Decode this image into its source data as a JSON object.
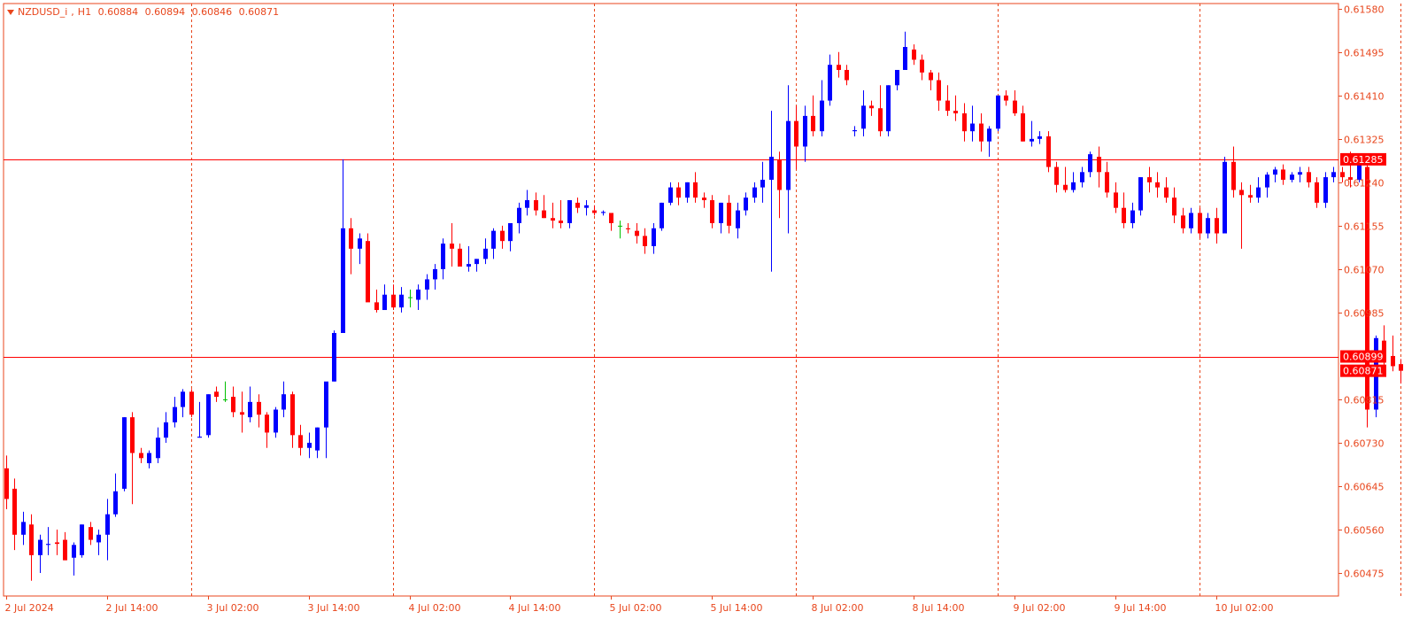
{
  "chart_data": {
    "type": "candlestick",
    "title": {
      "symbol": "NZDUSD_i",
      "timeframe": "H1",
      "open": "0.60884",
      "high": "0.60894",
      "low": "0.60846",
      "close": "0.60871"
    },
    "ylim": [
      0.6043,
      0.6159
    ],
    "y_ticks": [
      "0.61580",
      "0.61495",
      "0.61410",
      "0.61325",
      "0.61240",
      "0.61155",
      "0.61070",
      "0.60985",
      "0.60815",
      "0.60730",
      "0.60645",
      "0.60560",
      "0.60475"
    ],
    "x_ticks": [
      {
        "i": 0,
        "label": "2 Jul 2024"
      },
      {
        "i": 12,
        "label": "2 Jul 14:00"
      },
      {
        "i": 24,
        "label": "3 Jul 02:00"
      },
      {
        "i": 36,
        "label": "3 Jul 14:00"
      },
      {
        "i": 48,
        "label": "4 Jul 02:00"
      },
      {
        "i": 60,
        "label": "4 Jul 14:00"
      },
      {
        "i": 72,
        "label": "5 Jul 02:00"
      },
      {
        "i": 84,
        "label": "5 Jul 14:00"
      },
      {
        "i": 96,
        "label": "8 Jul 02:00"
      },
      {
        "i": 108,
        "label": "8 Jul 14:00"
      },
      {
        "i": 120,
        "label": "9 Jul 02:00"
      },
      {
        "i": 132,
        "label": "9 Jul 14:00"
      },
      {
        "i": 144,
        "label": "10 Jul 02:00"
      }
    ],
    "day_separators": [
      22,
      46,
      70,
      94,
      118,
      142,
      166
    ],
    "horizontal_lines": [
      {
        "value": 0.61285,
        "label": "0.61285"
      },
      {
        "value": 0.60899,
        "label": "0.60899"
      }
    ],
    "current_price": {
      "value": 0.60871,
      "label": "0.60871"
    },
    "colors": {
      "bull": "#0000ff",
      "bear": "#ff0000",
      "doji": "#00c000",
      "axis": "#e8461c",
      "grid": "#e8461c",
      "level_line": "#ff0000",
      "background": "#ffffff"
    },
    "candles": [
      [
        0.6068,
        0.60705,
        0.606,
        0.6062
      ],
      [
        0.6064,
        0.6066,
        0.6052,
        0.6055
      ],
      [
        0.6055,
        0.60595,
        0.6053,
        0.60575
      ],
      [
        0.6057,
        0.6059,
        0.6046,
        0.6051
      ],
      [
        0.6051,
        0.6055,
        0.60475,
        0.6054
      ],
      [
        0.6053,
        0.60565,
        0.6051,
        0.60532
      ],
      [
        0.60535,
        0.6056,
        0.6051,
        0.60532
      ],
      [
        0.6054,
        0.60555,
        0.605,
        0.605
      ],
      [
        0.60505,
        0.60535,
        0.6047,
        0.6053
      ],
      [
        0.6051,
        0.6057,
        0.60505,
        0.6057
      ],
      [
        0.60565,
        0.60575,
        0.6053,
        0.6054
      ],
      [
        0.60535,
        0.6056,
        0.6051,
        0.6055
      ],
      [
        0.6055,
        0.6062,
        0.605,
        0.6059
      ],
      [
        0.6059,
        0.6067,
        0.60585,
        0.60635
      ],
      [
        0.6064,
        0.6078,
        0.60635,
        0.6078
      ],
      [
        0.6078,
        0.6079,
        0.6061,
        0.6071
      ],
      [
        0.6071,
        0.6072,
        0.6069,
        0.607
      ],
      [
        0.6069,
        0.60715,
        0.6068,
        0.6071
      ],
      [
        0.607,
        0.6076,
        0.6069,
        0.6074
      ],
      [
        0.6074,
        0.6079,
        0.6073,
        0.6077
      ],
      [
        0.6077,
        0.6082,
        0.6076,
        0.608
      ],
      [
        0.608,
        0.60835,
        0.6078,
        0.6083
      ],
      [
        0.6083,
        0.60835,
        0.6078,
        0.60785
      ],
      [
        0.6074,
        0.6081,
        0.6074,
        0.60742
      ],
      [
        0.60745,
        0.60825,
        0.6074,
        0.60825
      ],
      [
        0.6083,
        0.6084,
        0.6081,
        0.6082
      ],
      [
        0.60815,
        0.6085,
        0.6081,
        0.60815
      ],
      [
        0.6082,
        0.6084,
        0.6078,
        0.6079
      ],
      [
        0.6079,
        0.6083,
        0.6075,
        0.60785
      ],
      [
        0.6078,
        0.6084,
        0.6077,
        0.6081
      ],
      [
        0.6081,
        0.60825,
        0.6076,
        0.60785
      ],
      [
        0.60785,
        0.6079,
        0.6072,
        0.6075
      ],
      [
        0.6075,
        0.608,
        0.6074,
        0.60795
      ],
      [
        0.60795,
        0.6085,
        0.6078,
        0.60825
      ],
      [
        0.60825,
        0.6083,
        0.6072,
        0.60745
      ],
      [
        0.60745,
        0.60765,
        0.60705,
        0.6072
      ],
      [
        0.6072,
        0.6075,
        0.607,
        0.6073
      ],
      [
        0.60715,
        0.6076,
        0.607,
        0.6076
      ],
      [
        0.6076,
        0.6084,
        0.607,
        0.6085
      ],
      [
        0.6085,
        0.6095,
        0.6085,
        0.60945
      ],
      [
        0.60945,
        0.61285,
        0.60945,
        0.6115
      ],
      [
        0.6115,
        0.6117,
        0.6106,
        0.6111
      ],
      [
        0.6111,
        0.6114,
        0.6108,
        0.6113
      ],
      [
        0.61125,
        0.6114,
        0.6104,
        0.61005
      ],
      [
        0.61005,
        0.6103,
        0.60985,
        0.6099
      ],
      [
        0.6099,
        0.6104,
        0.6099,
        0.6102
      ],
      [
        0.6102,
        0.6104,
        0.6099,
        0.60995
      ],
      [
        0.60995,
        0.61035,
        0.60985,
        0.6102
      ],
      [
        0.61015,
        0.6103,
        0.60995,
        0.61015
      ],
      [
        0.6101,
        0.6104,
        0.6099,
        0.6103
      ],
      [
        0.6103,
        0.6106,
        0.6101,
        0.6105
      ],
      [
        0.6105,
        0.6108,
        0.6103,
        0.6107
      ],
      [
        0.6107,
        0.6113,
        0.6105,
        0.6112
      ],
      [
        0.6112,
        0.6116,
        0.61075,
        0.6111
      ],
      [
        0.6111,
        0.6112,
        0.61075,
        0.61075
      ],
      [
        0.61075,
        0.61115,
        0.61065,
        0.6108
      ],
      [
        0.6108,
        0.6109,
        0.61065,
        0.6109
      ],
      [
        0.6109,
        0.6113,
        0.6108,
        0.6111
      ],
      [
        0.6111,
        0.6115,
        0.6109,
        0.61145
      ],
      [
        0.61145,
        0.61155,
        0.6111,
        0.61125
      ],
      [
        0.61125,
        0.6115,
        0.61105,
        0.6116
      ],
      [
        0.6116,
        0.612,
        0.6114,
        0.6119
      ],
      [
        0.6119,
        0.61225,
        0.61175,
        0.61205
      ],
      [
        0.61205,
        0.6122,
        0.61175,
        0.61185
      ],
      [
        0.61185,
        0.61215,
        0.6117,
        0.6117
      ],
      [
        0.6117,
        0.612,
        0.6115,
        0.61165
      ],
      [
        0.61165,
        0.61205,
        0.6115,
        0.6116
      ],
      [
        0.6116,
        0.61205,
        0.6115,
        0.61205
      ],
      [
        0.612,
        0.6121,
        0.6118,
        0.6119
      ],
      [
        0.6119,
        0.61205,
        0.61175,
        0.61195
      ],
      [
        0.61185,
        0.61195,
        0.61175,
        0.6118
      ],
      [
        0.6118,
        0.61185,
        0.61175,
        0.61182
      ],
      [
        0.6118,
        0.6118,
        0.61145,
        0.6116
      ],
      [
        0.61155,
        0.61165,
        0.6113,
        0.61155
      ],
      [
        0.6115,
        0.6116,
        0.6114,
        0.61148
      ],
      [
        0.61145,
        0.6116,
        0.6112,
        0.61135
      ],
      [
        0.61135,
        0.6115,
        0.611,
        0.61115
      ],
      [
        0.61115,
        0.6116,
        0.611,
        0.6115
      ],
      [
        0.6115,
        0.612,
        0.61145,
        0.612
      ],
      [
        0.612,
        0.6124,
        0.61195,
        0.6123
      ],
      [
        0.6123,
        0.6124,
        0.61195,
        0.6121
      ],
      [
        0.6121,
        0.6124,
        0.612,
        0.6124
      ],
      [
        0.6124,
        0.6126,
        0.612,
        0.6121
      ],
      [
        0.6121,
        0.6122,
        0.6119,
        0.61205
      ],
      [
        0.61205,
        0.61215,
        0.6115,
        0.6116
      ],
      [
        0.6116,
        0.612,
        0.6114,
        0.612
      ],
      [
        0.612,
        0.61215,
        0.6114,
        0.61155
      ],
      [
        0.6115,
        0.612,
        0.6113,
        0.61185
      ],
      [
        0.61185,
        0.6122,
        0.61175,
        0.6121
      ],
      [
        0.6121,
        0.6124,
        0.612,
        0.6123
      ],
      [
        0.6123,
        0.6128,
        0.612,
        0.61245
      ],
      [
        0.61245,
        0.6138,
        0.61065,
        0.6129
      ],
      [
        0.61285,
        0.613,
        0.6117,
        0.61225
      ],
      [
        0.61225,
        0.6143,
        0.6114,
        0.6136
      ],
      [
        0.6136,
        0.6139,
        0.61265,
        0.6131
      ],
      [
        0.6131,
        0.6139,
        0.6128,
        0.6137
      ],
      [
        0.6137,
        0.6141,
        0.6133,
        0.6134
      ],
      [
        0.6134,
        0.6144,
        0.6133,
        0.614
      ],
      [
        0.614,
        0.6149,
        0.6139,
        0.6147
      ],
      [
        0.6147,
        0.61495,
        0.61445,
        0.6146
      ],
      [
        0.6146,
        0.6147,
        0.6143,
        0.6144
      ],
      [
        0.6134,
        0.6135,
        0.6133,
        0.61342
      ],
      [
        0.61345,
        0.6142,
        0.6133,
        0.6139
      ],
      [
        0.6139,
        0.614,
        0.6137,
        0.61385
      ],
      [
        0.61385,
        0.6143,
        0.6133,
        0.6134
      ],
      [
        0.6134,
        0.6143,
        0.6133,
        0.6143
      ],
      [
        0.6143,
        0.6146,
        0.6142,
        0.6146
      ],
      [
        0.6146,
        0.61535,
        0.6146,
        0.61505
      ],
      [
        0.615,
        0.6151,
        0.6147,
        0.6148
      ],
      [
        0.6148,
        0.6149,
        0.6144,
        0.61455
      ],
      [
        0.61455,
        0.6146,
        0.6142,
        0.6144
      ],
      [
        0.6144,
        0.61455,
        0.6138,
        0.614
      ],
      [
        0.614,
        0.6143,
        0.6137,
        0.6138
      ],
      [
        0.6138,
        0.6141,
        0.6136,
        0.61375
      ],
      [
        0.61375,
        0.61395,
        0.6132,
        0.6134
      ],
      [
        0.6134,
        0.6139,
        0.6132,
        0.61355
      ],
      [
        0.61355,
        0.61375,
        0.613,
        0.6132
      ],
      [
        0.6132,
        0.6135,
        0.6129,
        0.61345
      ],
      [
        0.61345,
        0.6141,
        0.6134,
        0.6141
      ],
      [
        0.6141,
        0.6142,
        0.6139,
        0.614
      ],
      [
        0.614,
        0.6142,
        0.6137,
        0.61375
      ],
      [
        0.61375,
        0.6139,
        0.6132,
        0.6132
      ],
      [
        0.6132,
        0.6136,
        0.6131,
        0.61325
      ],
      [
        0.61325,
        0.6134,
        0.61315,
        0.6133
      ],
      [
        0.6133,
        0.6134,
        0.6126,
        0.6127
      ],
      [
        0.6127,
        0.6128,
        0.6122,
        0.61235
      ],
      [
        0.61235,
        0.6127,
        0.6122,
        0.61225
      ],
      [
        0.61225,
        0.6126,
        0.6122,
        0.6124
      ],
      [
        0.6124,
        0.6127,
        0.6123,
        0.6126
      ],
      [
        0.6126,
        0.613,
        0.6125,
        0.61295
      ],
      [
        0.6129,
        0.6131,
        0.6123,
        0.6126
      ],
      [
        0.6126,
        0.6128,
        0.6121,
        0.6122
      ],
      [
        0.6122,
        0.6124,
        0.6118,
        0.6119
      ],
      [
        0.6119,
        0.6122,
        0.6115,
        0.6116
      ],
      [
        0.6116,
        0.612,
        0.6115,
        0.61185
      ],
      [
        0.61185,
        0.6125,
        0.61175,
        0.6125
      ],
      [
        0.6125,
        0.6127,
        0.6122,
        0.6124
      ],
      [
        0.6124,
        0.6126,
        0.6121,
        0.6123
      ],
      [
        0.6123,
        0.6125,
        0.612,
        0.6121
      ],
      [
        0.6121,
        0.6123,
        0.6116,
        0.61175
      ],
      [
        0.61175,
        0.6119,
        0.6114,
        0.6115
      ],
      [
        0.6115,
        0.6119,
        0.6114,
        0.6118
      ],
      [
        0.6118,
        0.6119,
        0.6113,
        0.6114
      ],
      [
        0.6114,
        0.6118,
        0.6113,
        0.6117
      ],
      [
        0.6117,
        0.6119,
        0.6112,
        0.6114
      ],
      [
        0.6114,
        0.6129,
        0.6114,
        0.6128
      ],
      [
        0.6128,
        0.6131,
        0.6121,
        0.61225
      ],
      [
        0.61225,
        0.6124,
        0.6111,
        0.61215
      ],
      [
        0.61215,
        0.61235,
        0.612,
        0.6121
      ],
      [
        0.6121,
        0.6125,
        0.612,
        0.6123
      ],
      [
        0.6123,
        0.6126,
        0.6121,
        0.61255
      ],
      [
        0.61255,
        0.6127,
        0.6124,
        0.61265
      ],
      [
        0.61265,
        0.61275,
        0.61235,
        0.61245
      ],
      [
        0.61245,
        0.6126,
        0.6124,
        0.61255
      ],
      [
        0.61255,
        0.6127,
        0.6124,
        0.6126
      ],
      [
        0.6126,
        0.6127,
        0.6123,
        0.6124
      ],
      [
        0.6124,
        0.6125,
        0.6119,
        0.612
      ],
      [
        0.612,
        0.6126,
        0.6119,
        0.6125
      ],
      [
        0.6125,
        0.6127,
        0.6124,
        0.6126
      ],
      [
        0.6126,
        0.6127,
        0.6124,
        0.6125
      ],
      [
        0.6125,
        0.613,
        0.6123,
        0.61245
      ],
      [
        0.61245,
        0.6129,
        0.6124,
        0.61275
      ],
      [
        0.6127,
        0.6128,
        0.6076,
        0.60795
      ],
      [
        0.60795,
        0.6094,
        0.6078,
        0.60935
      ],
      [
        0.6093,
        0.6096,
        0.6088,
        0.609
      ],
      [
        0.609,
        0.6094,
        0.6087,
        0.6088
      ],
      [
        0.60884,
        0.60894,
        0.60846,
        0.60871
      ]
    ]
  }
}
